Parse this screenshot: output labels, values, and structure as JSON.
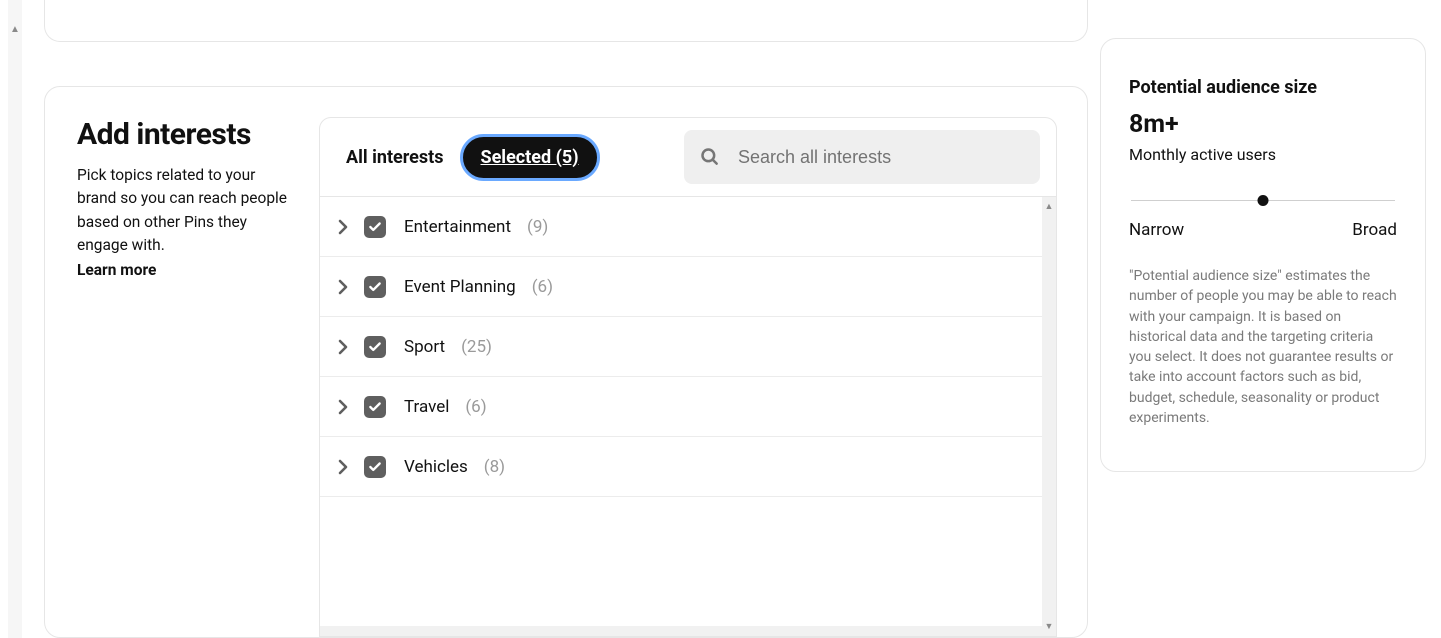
{
  "left": {
    "title": "Add interests",
    "description": "Pick topics related to your brand so you can reach people based on other Pins they engage with.",
    "learn_more": "Learn more"
  },
  "tabs": {
    "all": "All interests",
    "selected_label": "Selected (5)"
  },
  "search": {
    "placeholder": "Search all interests"
  },
  "interests": [
    {
      "name": "Entertainment",
      "count": "(9)"
    },
    {
      "name": "Event Planning",
      "count": "(6)"
    },
    {
      "name": "Sport",
      "count": "(25)"
    },
    {
      "name": "Travel",
      "count": "(6)"
    },
    {
      "name": "Vehicles",
      "count": "(8)"
    }
  ],
  "audience": {
    "heading": "Potential audience size",
    "value": "8m+",
    "sublabel": "Monthly active users",
    "narrow": "Narrow",
    "broad": "Broad",
    "disclaimer": "\"Potential audience size\" estimates the number of people you may be able to reach with your campaign. It is based on historical data and the targeting criteria you select. It does not guarantee results or take into account factors such as bid, budget, schedule, seasonality or product experiments."
  }
}
